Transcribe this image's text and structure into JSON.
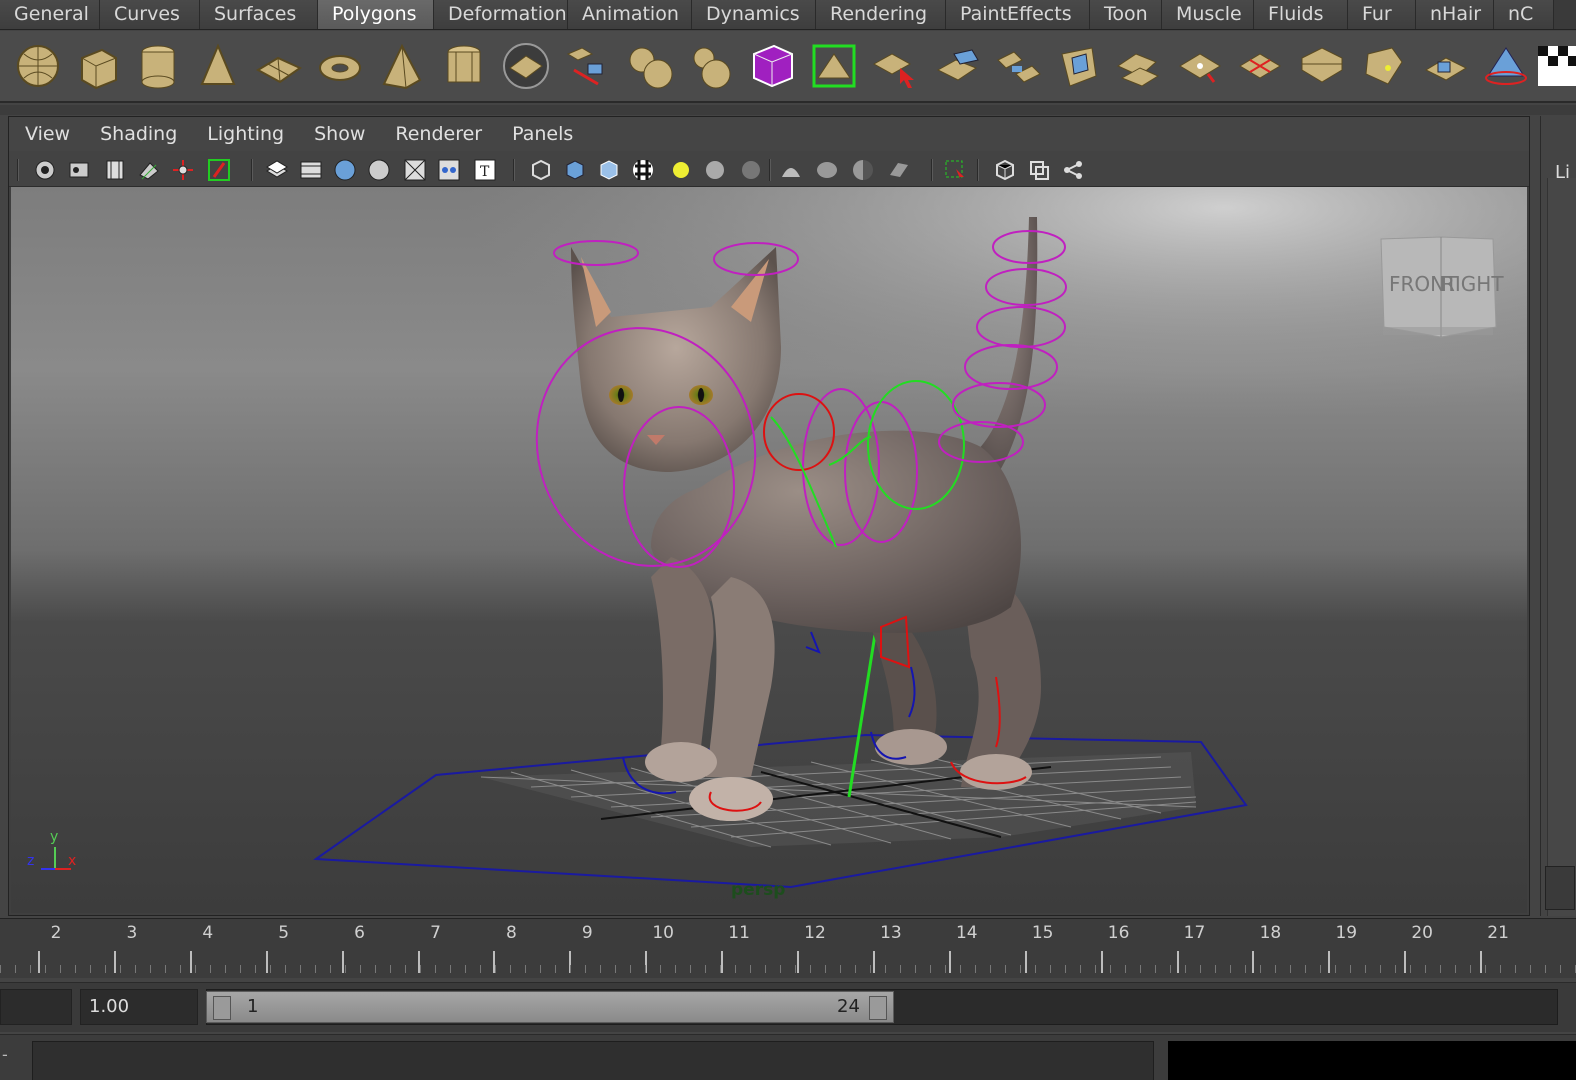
{
  "shelf_tabs": [
    "General",
    "Curves",
    "Surfaces",
    "Polygons",
    "Deformation",
    "Animation",
    "Dynamics",
    "Rendering",
    "PaintEffects",
    "Toon",
    "Muscle",
    "Fluids",
    "Fur",
    "nHair",
    "nC"
  ],
  "active_shelf_tab": "Polygons",
  "shelf_icons": [
    "poly-sphere-icon",
    "poly-cube-icon",
    "poly-cylinder-icon",
    "poly-cone-icon",
    "poly-plane-icon",
    "poly-torus-icon",
    "poly-pyramid-icon",
    "poly-pipe-icon",
    "poly-helix-icon",
    "extract-icon",
    "combine-icon",
    "separate-icon",
    "smooth-icon",
    "bevel-icon",
    "mirror-icon",
    "extrude-icon",
    "bridge-icon",
    "append-icon",
    "split-icon",
    "merge-icon",
    "fill-hole-icon",
    "insert-loop-icon",
    "offset-loop-icon",
    "collapse-icon",
    "triangulate-icon",
    "quadrangulate-icon",
    "uv-editor-icon",
    "checker-icon"
  ],
  "panel_menu": [
    "View",
    "Shading",
    "Lighting",
    "Show",
    "Renderer",
    "Panels"
  ],
  "panel_toolbar_icons": [
    "select-camera-icon",
    "camera-attributes-icon",
    "bookmark-icon",
    "image-plane-icon",
    "two-d-pan-icon",
    "grease-pencil-icon",
    "grid-icon",
    "film-gate-icon",
    "resolution-gate-icon",
    "gate-mask-icon",
    "field-chart-icon",
    "safe-action-icon",
    "safe-title-icon",
    "wireframe-icon",
    "smooth-shade-icon",
    "wireframe-on-shaded-icon",
    "textured-icon",
    "use-all-lights-icon",
    "shadows-icon",
    "screen-space-ao-icon",
    "motion-blur-icon",
    "multisample-aa-icon",
    "depth-of-field-icon",
    "xray-icon",
    "xray-joints-icon",
    "isolate-select-icon",
    "wireframe-cube-icon",
    "hud-icon",
    "share-icon"
  ],
  "viewport": {
    "camera_label": "persp",
    "view_cube": {
      "front": "FRONT",
      "right": "RIGHT"
    },
    "axis": {
      "x": "x",
      "y": "y",
      "z": "z"
    }
  },
  "right_strip": {
    "label": "Li"
  },
  "time_slider": {
    "ticks": [
      "2",
      "3",
      "4",
      "5",
      "6",
      "7",
      "8",
      "9",
      "10",
      "11",
      "12",
      "13",
      "14",
      "15",
      "16",
      "17",
      "18",
      "19",
      "20",
      "21"
    ]
  },
  "range_slider": {
    "playback_speed": "1.00",
    "min": "1",
    "max": "24"
  }
}
